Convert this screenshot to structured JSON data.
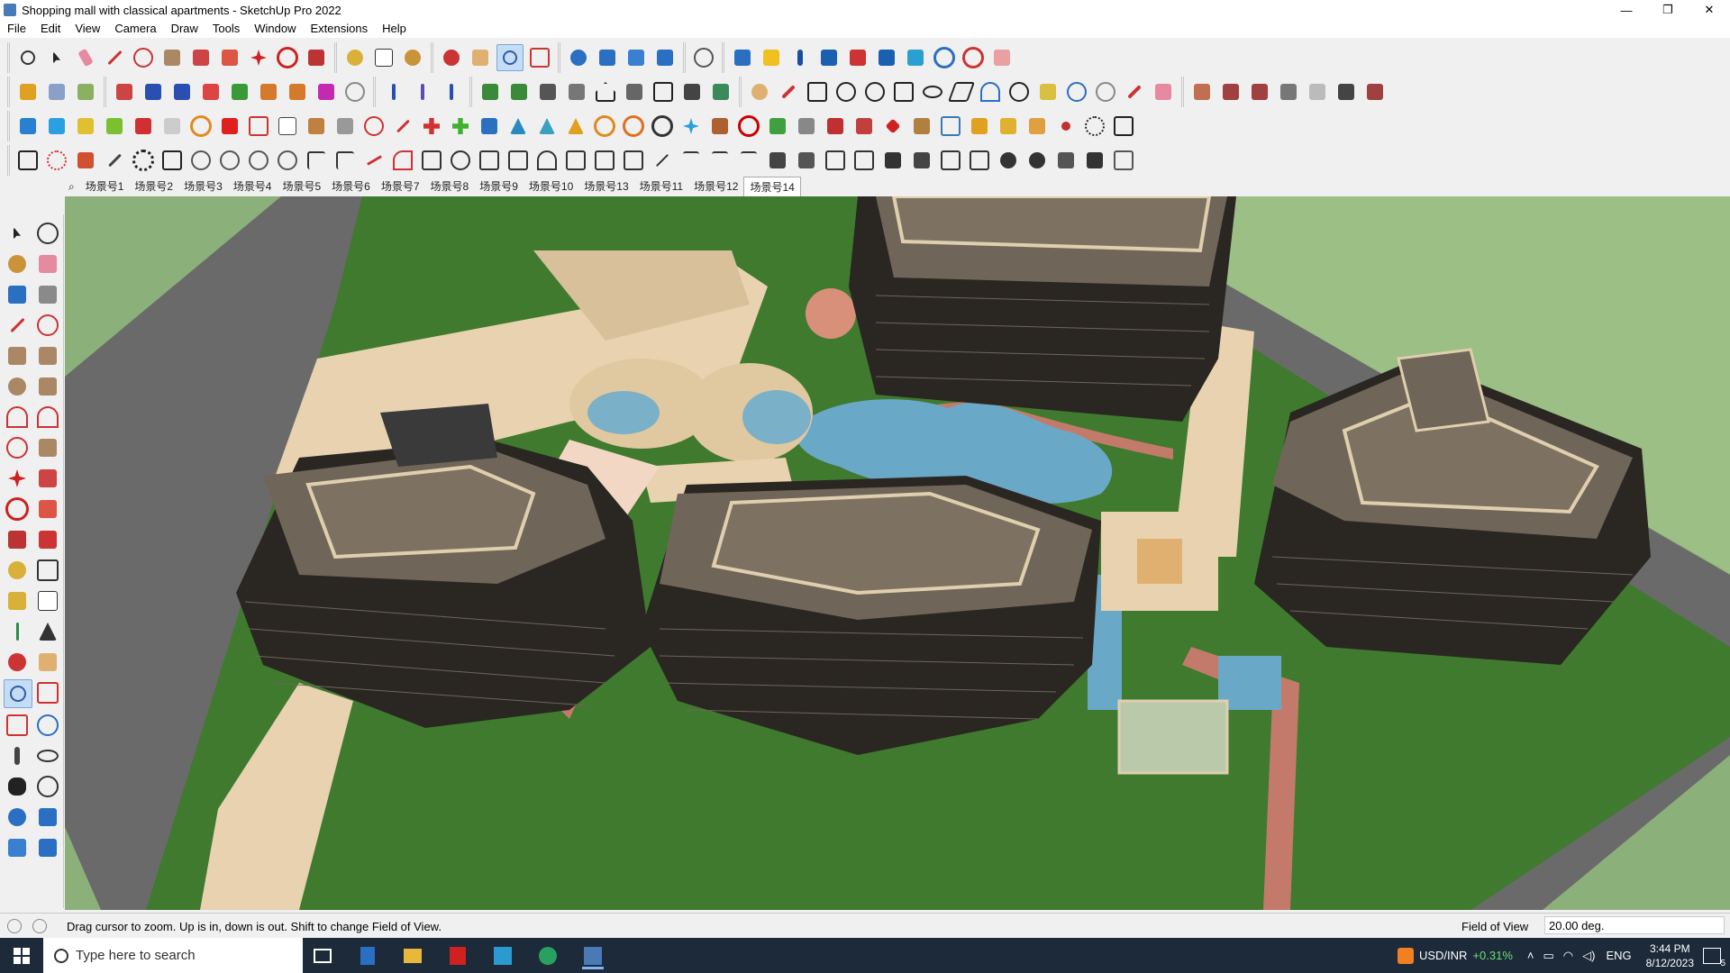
{
  "window": {
    "title": "Shopping mall with classical apartments - SketchUp Pro 2022",
    "controls": {
      "minimize": "—",
      "restore": "❐",
      "close": "✕"
    }
  },
  "menu": [
    "File",
    "Edit",
    "View",
    "Camera",
    "Draw",
    "Tools",
    "Window",
    "Extensions",
    "Help"
  ],
  "scenes": {
    "tabs": [
      "场景号1",
      "场景号2",
      "场景号3",
      "场景号4",
      "场景号5",
      "场景号6",
      "场景号7",
      "场景号8",
      "场景号9",
      "场景号10",
      "场景号13",
      "场景号11",
      "场景号12",
      "场景号14"
    ],
    "selected": "场景号14"
  },
  "status": {
    "hint": "Drag cursor to zoom.  Up is in, down is out. Shift to change Field of View.",
    "fov_label": "Field of View",
    "fov_value": "20.00 deg."
  },
  "taskbar": {
    "search_placeholder": "Type here to search",
    "ticker": "USD/INR",
    "ticker_change": "+0.31%",
    "lang": "ENG",
    "time": "3:44 PM",
    "date": "8/12/2023",
    "notification_count": "5"
  },
  "colors": {
    "grass": "#3f7a2e",
    "road": "#6a6a6a",
    "paving": "#e8d2b0",
    "water": "#6aa8c8",
    "roof": "#6f6558",
    "facade": "#2a2622",
    "ticker_green": "#6ee06e"
  }
}
